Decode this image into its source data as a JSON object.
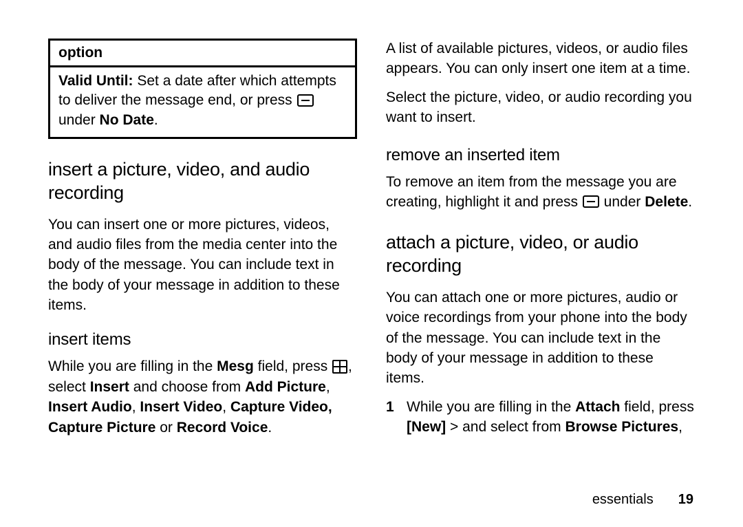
{
  "left": {
    "option_header": "option",
    "valid_label": "Valid Until:",
    "valid_text1": " Set a date after which attempts to deliver the message end, or press ",
    "valid_text2": " under ",
    "no_date": "No Date",
    "valid_text3": ".",
    "h_insert_pva": "insert a picture, video, and audio recording",
    "p_insert_desc": "You can insert one or more pictures, videos, and audio files from the media center into the body of the message. You can include text in the body of your message in addition to these items.",
    "h_insert_items": "insert items",
    "p_ii_1": "While you are filling in the ",
    "mesg": "Mesg",
    "p_ii_2": " field, press ",
    "p_ii_3": ", select ",
    "insert": "Insert",
    "p_ii_4": " and choose from ",
    "add_picture": "Add Picture",
    "comma1": ", ",
    "insert_audio": "Insert Audio",
    "comma2": ", ",
    "insert_video": "Insert Video",
    "comma3": ", ",
    "capture_video": "Capture Video,",
    "space1": " ",
    "capture_picture": "Capture Picture",
    "or": " or ",
    "record_voice": "Record Voice",
    "period": "."
  },
  "right": {
    "p_list": "A list of available pictures, videos, or audio files appears. You can only insert one item at a time.",
    "p_select": "Select the picture, video, or audio recording you want to insert.",
    "h_remove": "remove an inserted item",
    "p_rm_1": "To remove an item from the message you are creating, highlight it and press ",
    "p_rm_2": " under ",
    "delete": "Delete",
    "p_rm_3": ".",
    "h_attach": "attach a picture, video, or audio recording",
    "p_attach_desc": "You can attach one or more pictures, audio or voice recordings from your phone into the body of the message. You can include text in the body of your message in addition to these items.",
    "step1_num": "1",
    "s1_1": "While you are filling in the ",
    "attach": "Attach",
    "s1_2": " field, press ",
    "new": "[New]",
    "s1_3": " > and select from ",
    "browse_pictures": "Browse Pictures",
    "s1_4": ","
  },
  "footer": {
    "label": "essentials",
    "page": "19"
  }
}
